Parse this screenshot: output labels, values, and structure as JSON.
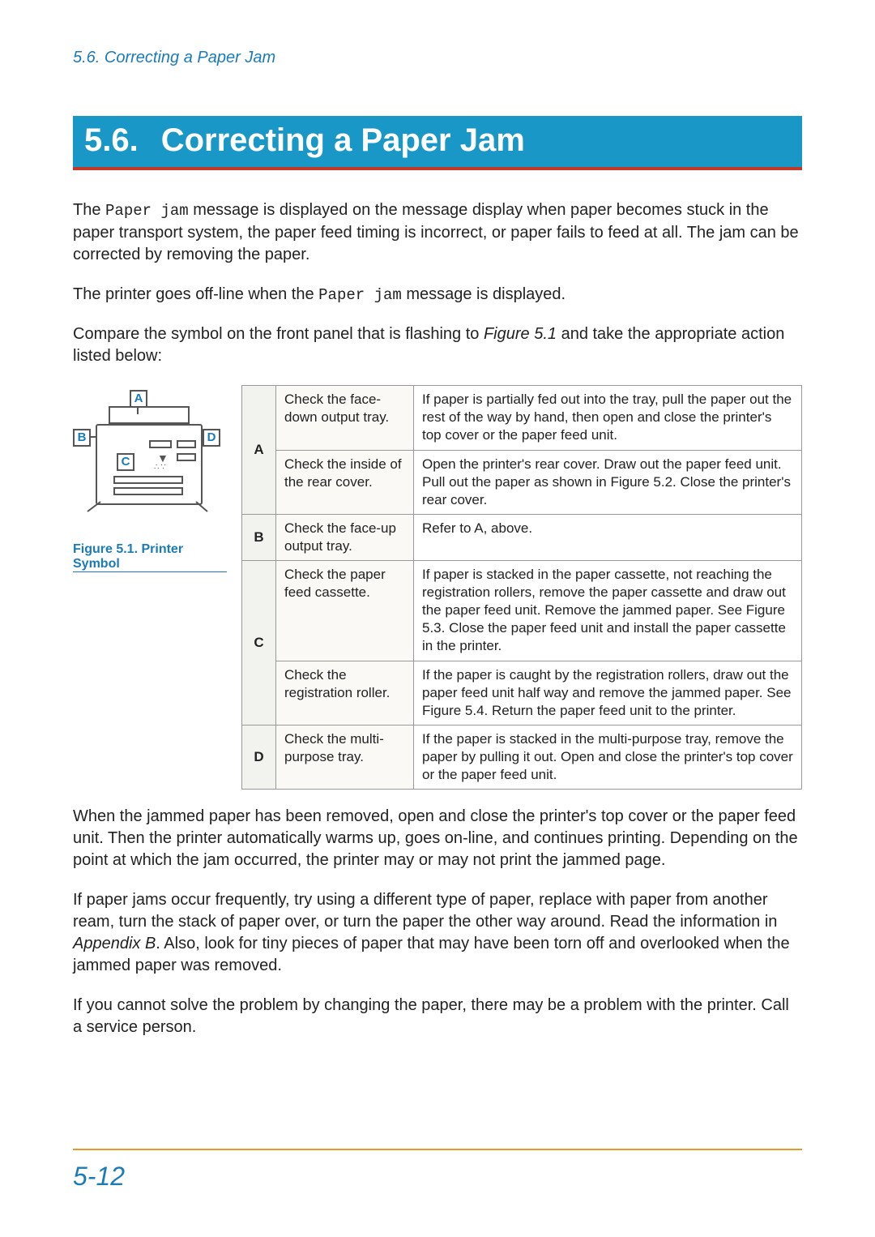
{
  "header": {
    "breadcrumb": "5.6. Correcting a Paper Jam"
  },
  "heading": {
    "number": "5.6.",
    "title": "Correcting a Paper Jam"
  },
  "paras": {
    "p1a": "The ",
    "p1mono": "Paper jam",
    "p1b": " message is displayed on the message display when paper becomes stuck in the paper transport system, the paper feed timing is incorrect, or paper fails to feed at all. The jam can be corrected by removing the paper.",
    "p2a": "The printer goes off-line when the ",
    "p2mono": "Paper jam",
    "p2b": " message is displayed.",
    "p3a": "Compare the symbol on the front panel that is flashing to ",
    "p3fig": "Figure 5.1",
    "p3b": " and take the appropriate action listed below:",
    "p4": "When the jammed paper has been removed, open and close the printer's top cover or the paper feed unit. Then the printer automatically warms up, goes on-line, and continues printing. Depending on the point at which the jam occurred, the printer may or may not print the jammed page.",
    "p5a": "If paper jams occur frequently, try using a different type of paper, replace with paper from another ream, turn the stack of paper over, or turn the paper the other way around. Read the information in ",
    "p5b": "Appendix B",
    "p5c": ". Also, look for tiny pieces of paper that may have been torn off and overlooked when the jammed paper was removed.",
    "p6": "If you cannot solve the problem by changing the paper, there may be a problem with the printer. Call a service person."
  },
  "figure": {
    "labels": {
      "A": "A",
      "B": "B",
      "C": "C",
      "D": "D"
    },
    "caption": "Figure 5.1. Printer Symbol"
  },
  "table": {
    "rows": [
      {
        "key": "A",
        "items": [
          {
            "check": "Check the face-down output tray.",
            "action": "If paper is partially fed out into the tray, pull the paper out the rest of the way by hand, then open and close the printer's top cover or the paper feed unit."
          },
          {
            "check": "Check the inside of the rear cover.",
            "action": "Open the printer's rear cover. Draw out the paper feed unit. Pull out the paper as shown in Figure 5.2. Close the printer's rear cover."
          }
        ]
      },
      {
        "key": "B",
        "items": [
          {
            "check": "Check the face-up output tray.",
            "action": "Refer to A, above."
          }
        ]
      },
      {
        "key": "C",
        "items": [
          {
            "check": "Check the paper feed cassette.",
            "action": "If paper is stacked in the paper cassette, not reaching the registration rollers, remove the paper cassette and draw out the paper feed unit. Remove the jammed paper. See Figure 5.3. Close the paper feed unit and install the paper cassette in the printer."
          },
          {
            "check": "Check the registration roller.",
            "action": "If the paper is caught by the registration rollers, draw out the paper feed unit half way and remove the jammed paper. See Figure 5.4. Return the paper feed unit to the printer."
          }
        ]
      },
      {
        "key": "D",
        "items": [
          {
            "check": "Check the multi-purpose tray.",
            "action": "If the paper is stacked in the multi-purpose tray, remove the paper by pulling it out. Open and close the printer's top cover or the paper feed unit."
          }
        ]
      }
    ]
  },
  "footer": {
    "page": "5-12"
  }
}
